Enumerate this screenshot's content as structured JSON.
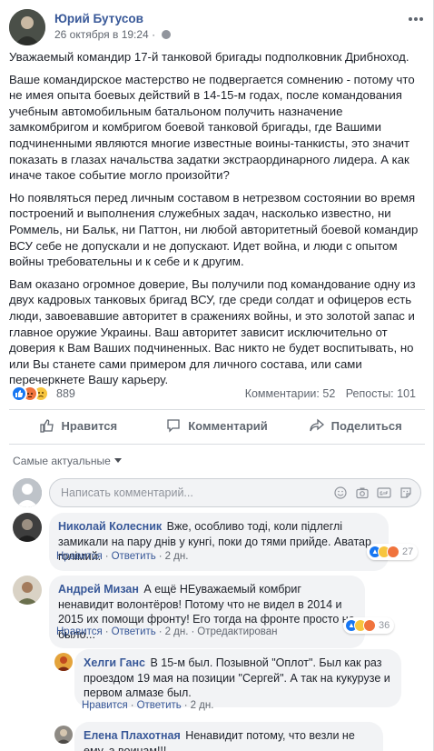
{
  "post": {
    "author": "Юрий Бутусов",
    "timestamp": "26 октября в 19:24",
    "timestamp_separator": "·",
    "paragraphs": [
      "Уважаемый командир 17-й танковой бригады подполковник Дрибноход.",
      "Ваше командирское мастерство не подвергается сомнению - потому что не имея опыта боевых действий в 14-15-м годах, после командования учебным автомобильным батальоном получить назначение замкомбригом и комбригом боевой танковой бригады, где Вашими подчиненными являются многие известные воины-танкисты, это значит показать в глазах начальства задатки экстраординарного лидера. А как иначе такое событие могло произойти?",
      "Но появляться перед личным составом в нетрезвом состоянии во время построений и выполнения служебных задач, насколько известно, ни Роммель, ни Бальк, ни Паттон, ни любой авторитетный боевой командир ВСУ себе не допускали и не допускают. Идет война, и люди с опытом войны требовательны и к себе и к другим.",
      "Вам оказано огромное доверие, Вы получили под командование одну из двух кадровых танковых бригад ВСУ, где среди солдат и офицеров есть люди, завоевавшие авторитет в сражениях войны, и это золотой запас и главное оружие Украины. Ваш авторитет зависит исключительно от доверия к Вам Ваших подчиненных. Вас никто не будет воспитывать, но или Вы станете сами примером для личного состава, или сами перечеркнете Вашу карьеру."
    ]
  },
  "reactions": {
    "count": "889",
    "comments": "Комментарии: 52",
    "shares": "Репосты: 101",
    "icons": [
      "like-icon",
      "angry-icon",
      "sad-icon"
    ],
    "colors": {
      "like": "#1877f2",
      "angry": "#f0733d",
      "sad": "#f7c53f"
    }
  },
  "actions": {
    "like": "Нравится",
    "comment": "Комментарий",
    "share": "Поделиться"
  },
  "comments_section": {
    "sort_label": "Самые актуальные",
    "composer_placeholder": "Написать комментарий...",
    "composer_tools": [
      "emoji-icon",
      "camera-icon",
      "gif-icon",
      "sticker-icon"
    ]
  },
  "comments": [
    {
      "author": "Николай Колесник",
      "text": "Вже, особливо тоді, коли підлеглі замикали на пару днів у кунгі, поки до тями прийде. Аватар голімий.",
      "like": "Нравится",
      "reply": "Ответить",
      "time": "2 дн.",
      "reaction_count": "27"
    },
    {
      "author": "Андрей Мизан",
      "text": "А ещё НЕуважаемый комбриг ненавидит волонтёров! Потому что не видел в 2014 и 2015 их помощи фронту! Его тогда на фронте просто не было...",
      "like": "Нравится",
      "reply": "Ответить",
      "time": "2 дн.",
      "edited": "Отредактирован",
      "reaction_count": "36"
    },
    {
      "author": "Хелги Ганс",
      "text": "В 15-м был. Позывной \"Оплот\". Был как раз проездом 19 мая на позиции \"Сергей\". А так на кукурузе и первом алмазе был.",
      "like": "Нравится",
      "reply": "Ответить",
      "time": "2 дн."
    },
    {
      "author": "Елена Плахотная",
      "text": "Ненавидит потому, что везли не ему, а воинам!!!"
    }
  ]
}
